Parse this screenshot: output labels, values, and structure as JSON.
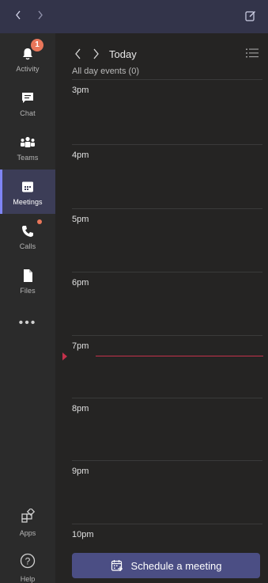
{
  "titlebar": {
    "back_icon": "chevron-left-icon",
    "forward_icon": "chevron-right-icon",
    "compose_icon": "compose-icon"
  },
  "rail": {
    "items": [
      {
        "label": "Activity",
        "icon": "bell-icon",
        "badge": "1"
      },
      {
        "label": "Chat",
        "icon": "chat-icon"
      },
      {
        "label": "Teams",
        "icon": "teams-icon"
      },
      {
        "label": "Meetings",
        "icon": "calendar-icon",
        "active": true
      },
      {
        "label": "Calls",
        "icon": "phone-icon",
        "dot": true
      },
      {
        "label": "Files",
        "icon": "file-icon"
      }
    ],
    "more_label": "•••",
    "bottom": [
      {
        "label": "Apps",
        "icon": "apps-icon"
      },
      {
        "label": "Help",
        "icon": "help-icon"
      }
    ],
    "accent": "#7f85f5"
  },
  "calendar": {
    "today_label": "Today",
    "all_day": "All day events (0)",
    "hours": [
      "3pm",
      "4pm",
      "5pm",
      "6pm",
      "7pm",
      "8pm",
      "9pm",
      "10pm"
    ],
    "now_color": "#c4314b"
  },
  "schedule": {
    "label": "Schedule a meeting",
    "icon": "calendar-add-icon",
    "color": "#4b4e84"
  },
  "colors": {
    "titlebar": "#33344a",
    "badge": "#e9765a"
  }
}
